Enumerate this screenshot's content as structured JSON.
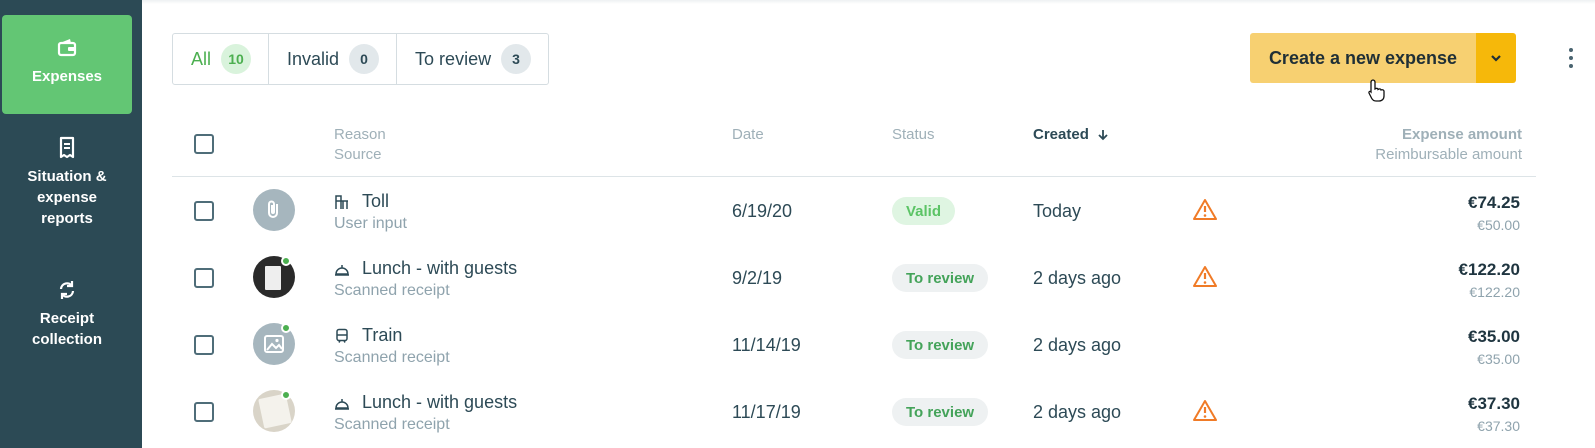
{
  "sidebar": {
    "items": [
      {
        "label": "Expenses",
        "icon": "wallet-icon",
        "active": true
      },
      {
        "label": "Situation & expense reports",
        "icon": "receipt-document-icon",
        "active": false
      },
      {
        "label": "Receipt collection",
        "icon": "sync-icon",
        "active": false
      }
    ]
  },
  "filters": {
    "tabs": [
      {
        "label": "All",
        "count": "10",
        "active": true
      },
      {
        "label": "Invalid",
        "count": "0",
        "active": false
      },
      {
        "label": "To review",
        "count": "3",
        "active": false
      }
    ]
  },
  "actions": {
    "create_label": "Create a new expense",
    "dropdown_icon": "chevron-down-icon",
    "more_icon": "more-vertical-icon"
  },
  "table": {
    "headers": {
      "reason": "Reason",
      "source": "Source",
      "date": "Date",
      "status": "Status",
      "created": "Created",
      "sort_icon": "arrow-down-icon",
      "amount": "Expense amount",
      "reimbursable": "Reimbursable amount"
    },
    "rows": [
      {
        "reason": "Toll",
        "reason_icon": "toll-icon",
        "source": "User input",
        "date": "6/19/20",
        "status": "Valid",
        "created": "Today",
        "warning": true,
        "amount": "€74.25",
        "reimbursable": "€50.00",
        "thumb": "paperclip-icon"
      },
      {
        "reason": "Lunch - with guests",
        "reason_icon": "meal-icon",
        "source": "Scanned receipt",
        "date": "9/2/19",
        "status": "To review",
        "created": "2 days ago",
        "warning": true,
        "amount": "€122.20",
        "reimbursable": "€122.20",
        "thumb": "receipt-photo"
      },
      {
        "reason": "Train",
        "reason_icon": "train-icon",
        "source": "Scanned receipt",
        "date": "11/14/19",
        "status": "To review",
        "created": "2 days ago",
        "warning": false,
        "amount": "€35.00",
        "reimbursable": "€35.00",
        "thumb": "image-icon"
      },
      {
        "reason": "Lunch - with guests",
        "reason_icon": "meal-icon",
        "source": "Scanned receipt",
        "date": "11/17/19",
        "status": "To review",
        "created": "2 days ago",
        "warning": true,
        "amount": "€37.30",
        "reimbursable": "€37.30",
        "thumb": "receipt-photo"
      }
    ]
  },
  "colors": {
    "sidebar_bg": "#2c4a55",
    "active_green": "#63c674",
    "create_button": "#f7d071",
    "create_dropdown": "#f6b80a",
    "warning_orange": "#f07b27"
  }
}
